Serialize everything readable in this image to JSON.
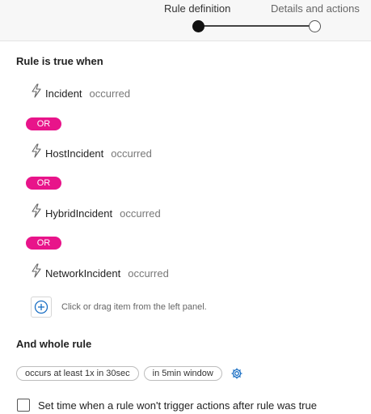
{
  "stepper": {
    "steps": [
      {
        "label": "Rule definition",
        "active": true
      },
      {
        "label": "Details and actions",
        "active": false
      }
    ]
  },
  "rule_section": {
    "title": "Rule is true when",
    "events": [
      {
        "name": "Incident",
        "state": "occurred",
        "icon": "lightning-bolt-icon"
      },
      {
        "name": "HostIncident",
        "state": "occurred",
        "icon": "lightning-bolt-icon"
      },
      {
        "name": "HybridIncident",
        "state": "occurred",
        "icon": "lightning-bolt-icon"
      },
      {
        "name": "NetworkIncident",
        "state": "occurred",
        "icon": "lightning-bolt-icon"
      }
    ],
    "operator_label": "OR",
    "operator_color": "#e8148a",
    "add_hint": "Click or drag item from the left panel.",
    "add_icon": "plus-circle-icon"
  },
  "whole_rule": {
    "title": "And whole rule",
    "chips": [
      "occurs at least 1x in 30sec",
      "in 5min window"
    ],
    "settings_icon": "gear-icon",
    "accent_color": "#1a6fc4"
  },
  "checkbox": {
    "label": "Set time when a rule won't trigger actions after rule was true",
    "checked": false
  }
}
